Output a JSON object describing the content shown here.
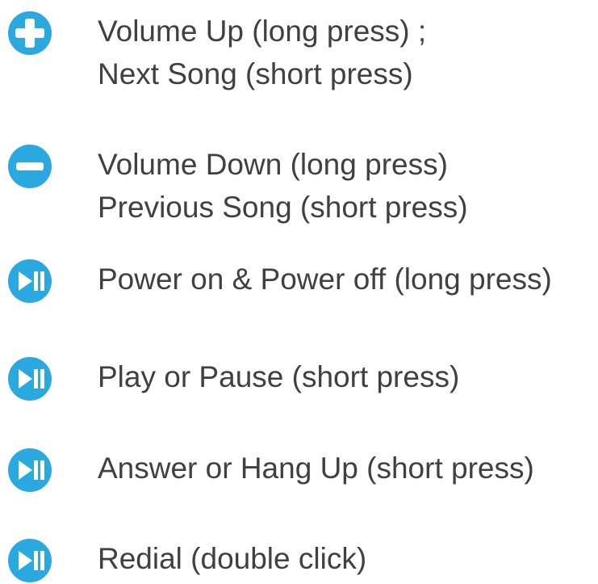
{
  "accent_color": "#2aa8e0",
  "text_color": "#404040",
  "items": [
    {
      "icon": "plus-icon",
      "line1": "Volume Up (long press) ;",
      "line2": "Next Song (short press)"
    },
    {
      "icon": "minus-icon",
      "line1": "Volume Down (long press)",
      "line2": "Previous Song (short press)"
    },
    {
      "icon": "play-pause-icon",
      "line1": "Power on & Power off (long press)"
    },
    {
      "icon": "play-pause-icon",
      "line1": "Play or Pause (short press)"
    },
    {
      "icon": "play-pause-icon",
      "line1": "Answer or Hang Up (short press)"
    },
    {
      "icon": "play-pause-icon",
      "line1": "Redial (double click)"
    }
  ]
}
